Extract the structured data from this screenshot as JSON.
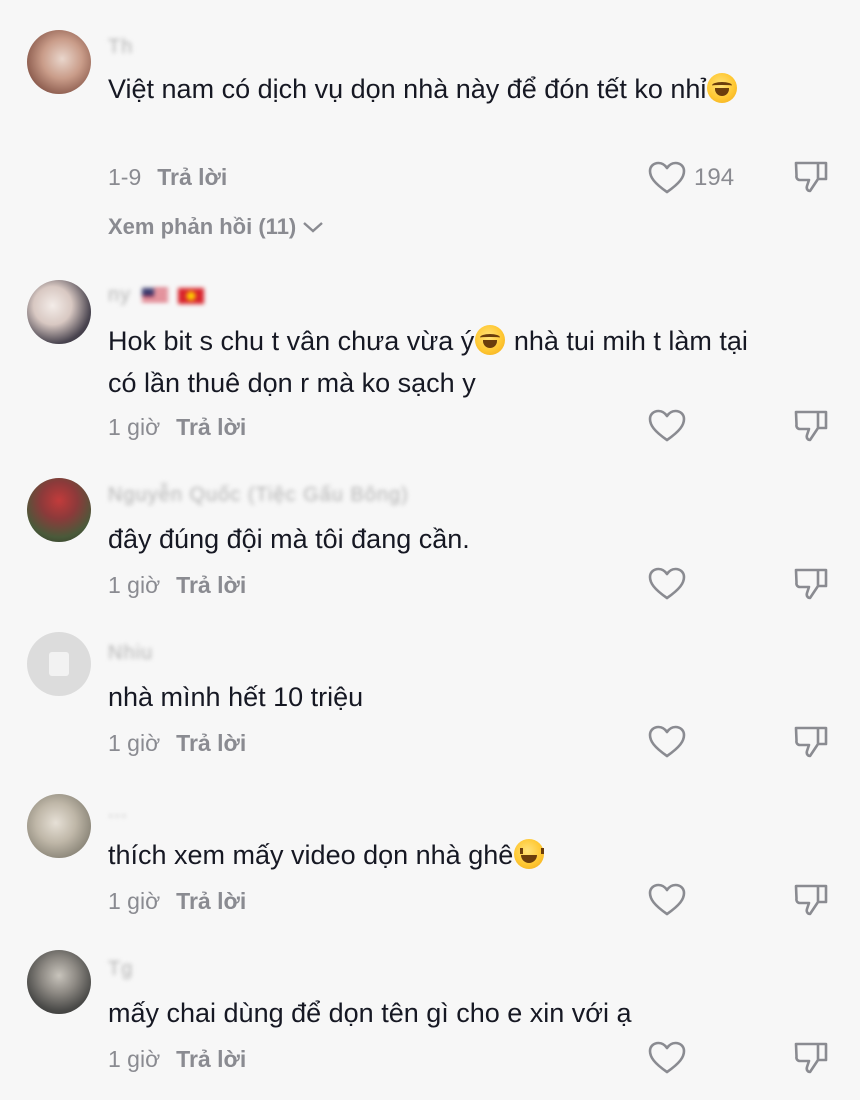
{
  "comments": [
    {
      "username": "Th",
      "text_1": "Việt nam có dịch vụ dọn nhà này để đón tết ko nhỉ",
      "emoji": "laughing-tears",
      "time": "1-9",
      "reply_label": "Trả lời",
      "likes": "194",
      "view_replies_label": "Xem phản hồi (11)"
    },
    {
      "username": "ny",
      "flags": [
        "us-flag",
        "vn-flag"
      ],
      "text_1": "Hok bit s chu t vân chưa vừa ý",
      "emoji": "laughing-tears",
      "text_2": " nhà tui mih t làm tại có lần thuê dọn r mà ko sạch y",
      "time": "1 giờ",
      "reply_label": "Trả lời"
    },
    {
      "username": "Nguyễn Quốc (Tiệc Gấu Bông)",
      "text_1": "đây đúng đội mà tôi đang cần.",
      "time": "1 giờ",
      "reply_label": "Trả lời"
    },
    {
      "username": "Nhiu",
      "text_1": "nhà mình hết 10 triệu",
      "time": "1 giờ",
      "reply_label": "Trả lời"
    },
    {
      "username": "...",
      "text_1": "thích xem mấy video dọn nhà ghê",
      "emoji": "grinning-squint",
      "time": "1 giờ",
      "reply_label": "Trả lời"
    },
    {
      "username": "Tg",
      "text_1": "mấy chai dùng để dọn tên gì cho e xin với ạ",
      "time": "1 giờ",
      "reply_label": "Trả lời"
    }
  ]
}
